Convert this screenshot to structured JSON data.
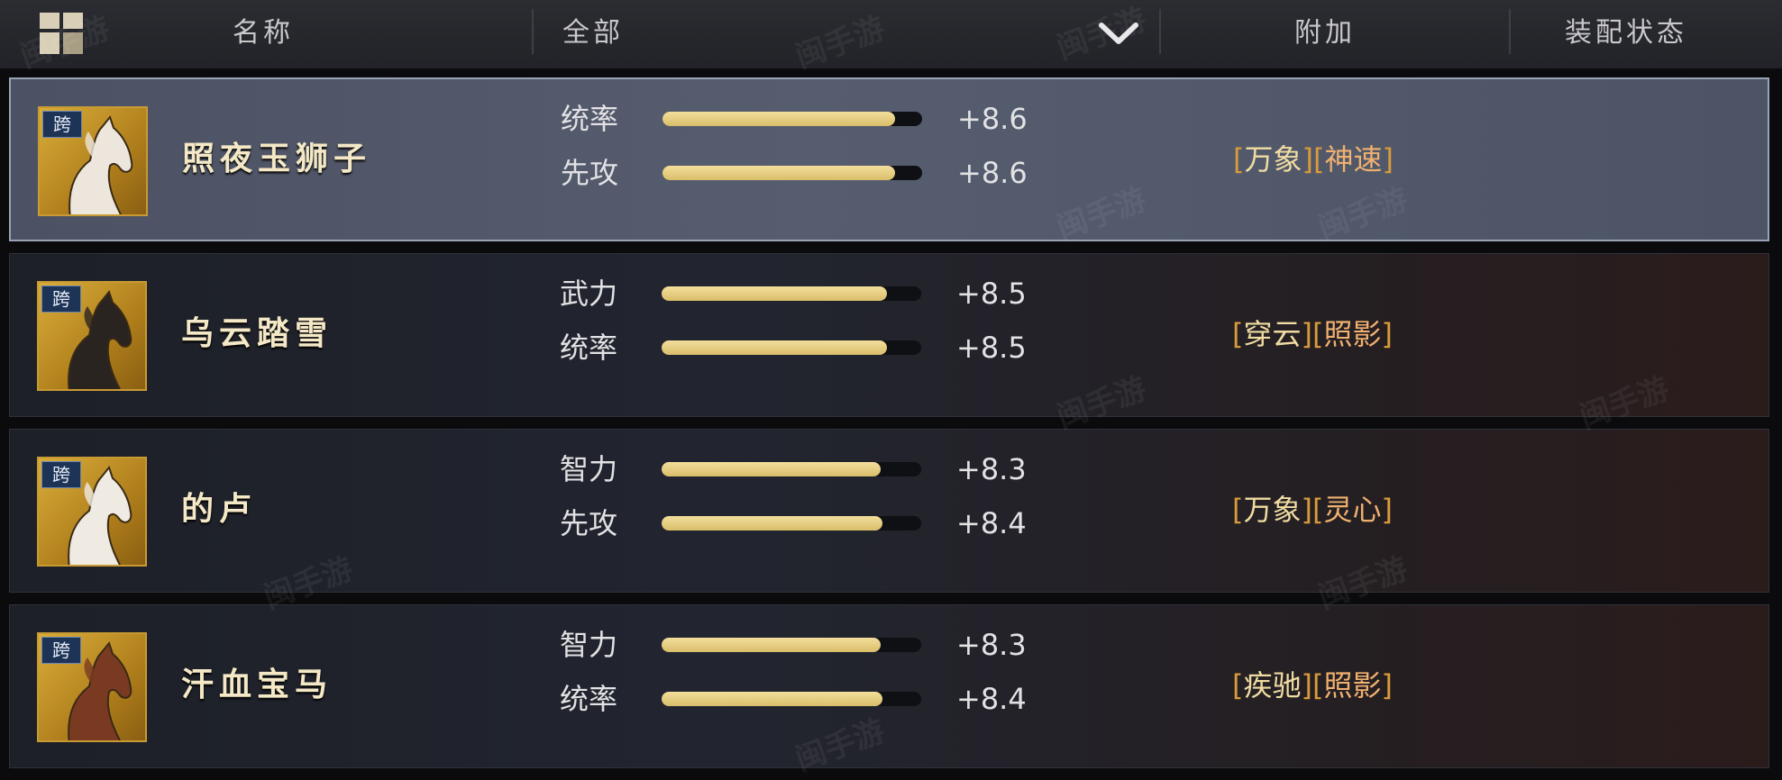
{
  "header": {
    "name_col": "名称",
    "filter_value": "全部",
    "extra_col": "附加",
    "status_col": "装配状态"
  },
  "rows": [
    {
      "tag": "跨",
      "name": "照夜玉狮子",
      "selected": true,
      "horse_color": "#ece6dc",
      "stats": [
        {
          "label": "统率",
          "value": "+8.6",
          "fill": 1.0
        },
        {
          "label": "先攻",
          "value": "+8.6",
          "fill": 1.0
        }
      ],
      "attrs": [
        "万象",
        "神速"
      ]
    },
    {
      "tag": "跨",
      "name": "乌云踏雪",
      "selected": false,
      "horse_color": "#2a2420",
      "stats": [
        {
          "label": "武力",
          "value": "+8.5",
          "fill": 0.97
        },
        {
          "label": "统率",
          "value": "+8.5",
          "fill": 0.97
        }
      ],
      "attrs": [
        "穿云",
        "照影"
      ]
    },
    {
      "tag": "跨",
      "name": "的卢",
      "selected": false,
      "horse_color": "#efeae2",
      "stats": [
        {
          "label": "智力",
          "value": "+8.3",
          "fill": 0.94
        },
        {
          "label": "先攻",
          "value": "+8.4",
          "fill": 0.95
        }
      ],
      "attrs": [
        "万象",
        "灵心"
      ]
    },
    {
      "tag": "跨",
      "name": "汗血宝马",
      "selected": false,
      "horse_color": "#7a3a22",
      "stats": [
        {
          "label": "智力",
          "value": "+8.3",
          "fill": 0.94
        },
        {
          "label": "统率",
          "value": "+8.4",
          "fill": 0.95
        }
      ],
      "attrs": [
        "疾驰",
        "照影"
      ]
    }
  ],
  "colors": {
    "accent_gold": "#e8d08a",
    "bracket": "#d99a3c",
    "selected_row_bg": "#565d6f"
  },
  "icons": {
    "sort_toggle": "grid-icon",
    "filter_dropdown": "chevron-down-icon",
    "portrait": "horse-icon"
  }
}
